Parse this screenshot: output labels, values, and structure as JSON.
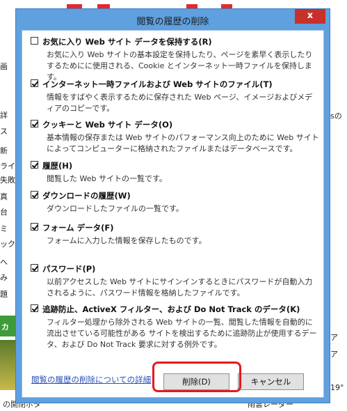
{
  "dialog": {
    "title": "閲覧の履歴の削除",
    "close": "x"
  },
  "options": [
    {
      "label": "お気に入り Web サイト データを保持する(R)",
      "checked": false,
      "desc": "お気に入り Web サイトの基本設定を保持したり、ページを素早く表示したりするためにに使用される、Cookie とインターネット一時ファイルを保持します。"
    },
    {
      "label": "インターネット一時ファイルおよび Web サイトのファイル(T)",
      "checked": true,
      "desc": "情報をすばやく表示するために保存された Web ページ、イメージおよびメディアのコピーです。"
    },
    {
      "label": "クッキーと Web サイト データ(O)",
      "checked": true,
      "desc": "基本情報の保存または Web サイトのパフォーマンス向上のために Web サイトによってコンピューターに格納されたファイルまたはデータベースです。"
    },
    {
      "label": "履歴(H)",
      "checked": true,
      "desc": "閲覧した Web サイトの一覧です。"
    },
    {
      "label": "ダウンロードの履歴(W)",
      "checked": true,
      "desc": "ダウンロードしたファイルの一覧です。"
    },
    {
      "label": "フォーム データ(F)",
      "checked": true,
      "desc": "フォームに入力した情報を保存したものです。"
    },
    {
      "label": "パスワード(P)",
      "checked": true,
      "desc": "以前アクセスした Web サイトにサインインするときにパスワードが自動入力されるように、パスワード情報を格納したファイルです。"
    },
    {
      "label": "追跡防止、ActiveX フィルター、および Do Not Track のデータ(K)",
      "checked": true,
      "desc": "フィルター処理から除外される Web サイトの一覧、閲覧した情報を自動的に流出させている可能性がある サイトを検出するために追跡防止が使用するデータ、および Do Not Track 要求に対する例外です。"
    }
  ],
  "footer": {
    "link": "閲覧の履歴の削除についての詳細",
    "delete_button": "削除(D)",
    "cancel_button": "キャンセル"
  },
  "background": {
    "left_fragments": [
      "画",
      "詳",
      "ス",
      "新",
      "ライ",
      "失敗",
      "真",
      "台",
      "ミ",
      "ック",
      "へ",
      "み",
      "題",
      "カ"
    ],
    "right_fragments": [
      "sの",
      "ア",
      "ア",
      "19°"
    ],
    "bottom_left": "の開閉ボタ",
    "bottom_right": "雨雲レーダー"
  },
  "colors": {
    "title_bar": "#5fa0de",
    "close_button": "#c7312b",
    "highlight": "#e5191d",
    "link": "#2a4fb8"
  }
}
